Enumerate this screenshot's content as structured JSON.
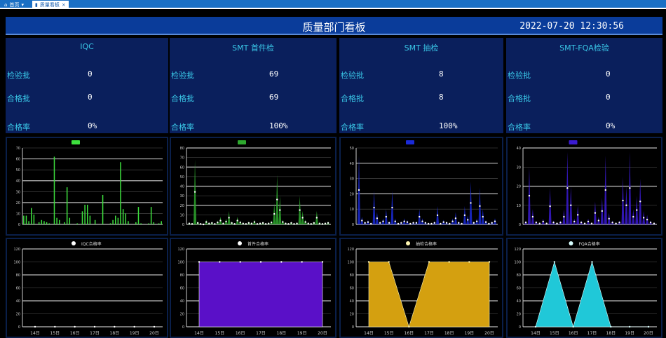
{
  "tabs": [
    {
      "label": "首页",
      "icon": "home-icon"
    },
    {
      "label": "质量看板",
      "icon": "shield-icon"
    }
  ],
  "header": {
    "title": "质量部门看板",
    "datetime": "2022-07-20 12:30:56"
  },
  "stats": [
    {
      "title": "IQC",
      "rows": [
        {
          "label": "检验批",
          "value": "0"
        },
        {
          "label": "合格批",
          "value": "0"
        },
        {
          "label": "合格率",
          "value": "0%"
        }
      ]
    },
    {
      "title": "SMT 首件检",
      "rows": [
        {
          "label": "检验批",
          "value": "69"
        },
        {
          "label": "合格批",
          "value": "69"
        },
        {
          "label": "合格率",
          "value": "100%"
        }
      ]
    },
    {
      "title": "SMT 抽检",
      "rows": [
        {
          "label": "检验批",
          "value": "8"
        },
        {
          "label": "合格批",
          "value": "8"
        },
        {
          "label": "合格率",
          "value": "100%"
        }
      ]
    },
    {
      "title": "SMT-FQA检验",
      "rows": [
        {
          "label": "检验批",
          "value": "0"
        },
        {
          "label": "合格批",
          "value": "0"
        },
        {
          "label": "合格率",
          "value": "0%"
        }
      ]
    }
  ],
  "chart_data": [
    {
      "type": "bar",
      "legend": "",
      "color": "#3ee03e",
      "ylim": [
        0,
        70
      ],
      "yticks": [
        0,
        10,
        20,
        30,
        40,
        50,
        60,
        70
      ],
      "values": [
        8,
        8,
        3,
        15,
        9,
        0,
        2,
        4,
        3,
        2,
        1,
        0,
        62,
        6,
        4,
        0,
        2,
        34,
        6,
        0,
        0,
        1,
        0,
        12,
        18,
        18,
        8,
        0,
        4,
        0,
        0,
        27,
        0,
        0,
        1,
        4,
        8,
        6,
        57,
        14,
        10,
        3,
        0,
        0,
        2,
        16,
        1,
        0,
        0,
        1,
        16,
        2,
        0,
        1,
        3
      ]
    },
    {
      "type": "line",
      "legend": "",
      "color": "#2ea82e",
      "ylim": [
        0,
        80
      ],
      "yticks": [
        0,
        10,
        20,
        30,
        40,
        50,
        60,
        70,
        80
      ],
      "values": [
        2,
        1,
        68,
        3,
        1,
        0,
        5,
        2,
        3,
        1,
        4,
        8,
        2,
        6,
        14,
        3,
        1,
        8,
        4,
        2,
        1,
        3,
        2,
        5,
        1,
        2,
        3,
        1,
        2,
        4,
        22,
        52,
        30,
        5,
        2,
        1,
        3,
        1,
        2,
        30,
        14,
        5,
        2,
        1,
        3,
        14,
        2,
        1,
        2,
        3
      ]
    },
    {
      "type": "line",
      "legend": "",
      "color": "#1a2ad8",
      "ylim": [
        0,
        50
      ],
      "yticks": [
        0,
        10,
        20,
        30,
        40,
        50
      ],
      "values": [
        45,
        5,
        2,
        3,
        1,
        22,
        8,
        2,
        4,
        10,
        2,
        22,
        4,
        1,
        2,
        4,
        3,
        1,
        2,
        2,
        10,
        4,
        2,
        1,
        1,
        2,
        12,
        1,
        3,
        2,
        1,
        4,
        8,
        2,
        1,
        12,
        6,
        28,
        2,
        4,
        24,
        10,
        3,
        1,
        2,
        4
      ]
    },
    {
      "type": "line",
      "legend": "",
      "color": "#3a1ad0",
      "ylim": [
        0,
        40
      ],
      "yticks": [
        0,
        10,
        20,
        30,
        40
      ],
      "values": [
        2,
        30,
        8,
        2,
        1,
        3,
        1,
        19,
        2,
        1,
        2,
        8,
        38,
        20,
        3,
        10,
        2,
        1,
        3,
        1,
        12,
        4,
        14,
        36,
        6,
        2,
        1,
        2,
        25,
        20,
        38,
        8,
        15,
        24,
        7,
        5,
        2,
        1
      ]
    },
    {
      "type": "area",
      "legend": "IQC合格率",
      "color": "#ffffff",
      "fill": "#5a10c8",
      "ylim": [
        0,
        120
      ],
      "yticks": [
        0,
        20,
        40,
        60,
        80,
        100,
        120
      ],
      "categories": [
        "14日",
        "15日",
        "16日",
        "17日",
        "18日",
        "19日",
        "20日"
      ],
      "values": [
        0,
        0,
        0,
        0,
        0,
        0,
        0
      ]
    },
    {
      "type": "area",
      "legend": "首件合格率",
      "color": "#ffffff",
      "fill": "#5a10c8",
      "ylim": [
        0,
        120
      ],
      "yticks": [
        0,
        20,
        40,
        60,
        80,
        100,
        120
      ],
      "categories": [
        "14日",
        "15日",
        "16日",
        "17日",
        "18日",
        "19日",
        "20日"
      ],
      "values": [
        100,
        100,
        100,
        100,
        100,
        100,
        100
      ]
    },
    {
      "type": "area",
      "legend": "抽检合格率",
      "color": "#fff6b0",
      "fill": "#d4a010",
      "ylim": [
        0,
        120
      ],
      "yticks": [
        0,
        20,
        40,
        60,
        80,
        100,
        120
      ],
      "categories": [
        "14日",
        "15日",
        "16日",
        "17日",
        "18日",
        "19日",
        "20日"
      ],
      "values": [
        100,
        100,
        0,
        100,
        100,
        100,
        100
      ]
    },
    {
      "type": "area",
      "legend": "FQA合格率",
      "color": "#d8ffff",
      "fill": "#20c8d8",
      "ylim": [
        0,
        120
      ],
      "yticks": [
        0,
        20,
        40,
        60,
        80,
        100,
        120
      ],
      "categories": [
        "14日",
        "15日",
        "16日",
        "17日",
        "18日",
        "19日",
        "20日"
      ],
      "values": [
        0,
        100,
        0,
        100,
        0,
        0,
        0
      ]
    }
  ]
}
